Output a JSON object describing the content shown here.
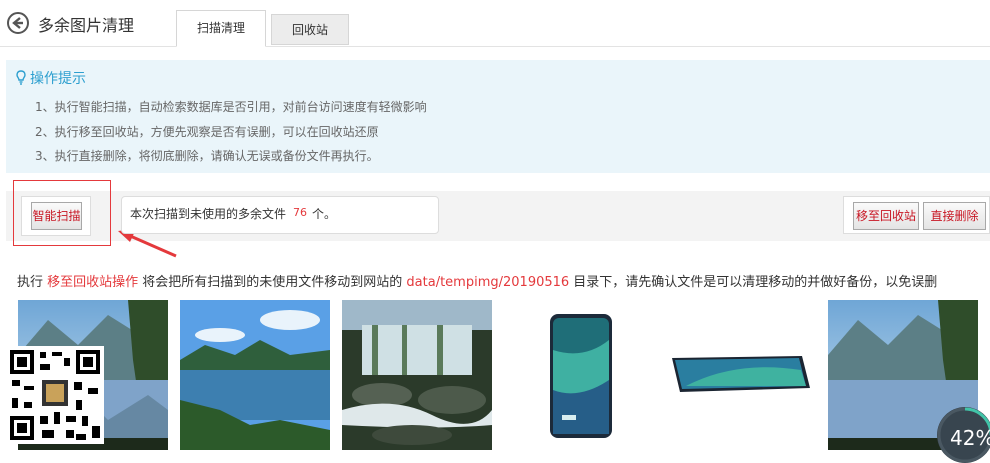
{
  "header": {
    "title": "多余图片清理",
    "tabs": [
      {
        "label": "扫描清理",
        "active": true
      },
      {
        "label": "回收站",
        "active": false
      }
    ]
  },
  "tips": {
    "title": "操作提示",
    "items": [
      "1、执行智能扫描，自动检索数据库是否引用，对前台访问速度有轻微影响",
      "2、执行移至回收站，方便先观察是否有误删，可以在回收站还原",
      "3、执行直接删除，将彻底删除，请确认无误或备份文件再执行。"
    ]
  },
  "toolbar": {
    "scan_label": "智能扫描",
    "result_prefix": "本次扫描到未使用的多余文件",
    "result_count": "76",
    "result_suffix": "个。",
    "recycle_label": "移至回收站",
    "delete_label": "直接删除"
  },
  "notice": {
    "p1": "执行 ",
    "action": "移至回收站操作",
    "p2": " 将会把所有扫描到的未使用文件移动到网站的 ",
    "path": "data/tempimg/20190516",
    "p3": " 目录下，请先确认文件是可以清理移动的并做好备份，以免误删"
  },
  "thumbnails": [
    {
      "icon": "lake-mountain-image"
    },
    {
      "icon": "lake-island-image"
    },
    {
      "icon": "waterfall-image"
    },
    {
      "icon": "phone-front-image"
    },
    {
      "icon": "phone-flat-image"
    },
    {
      "icon": "lake-mountain-image"
    }
  ],
  "widget": {
    "progress_text": "42%",
    "progress": 0.42
  },
  "colors": {
    "accent": "#2d9fcf",
    "danger": "#e4393c",
    "tips_bg": "#eaf5fa"
  }
}
